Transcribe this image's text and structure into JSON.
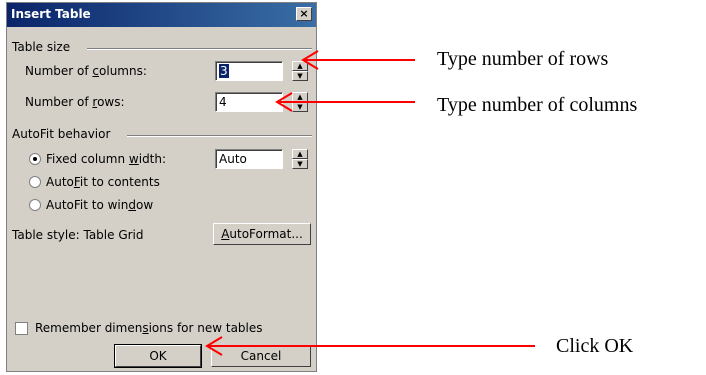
{
  "dialog": {
    "title": "Insert Table",
    "close_label": "×",
    "table_size": {
      "heading": "Table size",
      "columns_label_pre": "Number of ",
      "columns_label_u": "c",
      "columns_label_post": "olumns:",
      "columns_value": "3",
      "rows_label_pre": "Number of ",
      "rows_label_u": "r",
      "rows_label_post": "ows:",
      "rows_value": "4"
    },
    "autofit": {
      "heading": "AutoFit behavior",
      "fixed_pre": "Fixed column ",
      "fixed_u": "w",
      "fixed_post": "idth:",
      "fixed_value": "Auto",
      "contents_pre": "Auto",
      "contents_u": "F",
      "contents_post": "it to contents",
      "window_pre": "AutoFit to win",
      "window_u": "d",
      "window_post": "ow"
    },
    "table_style_label": "Table style: Table Grid",
    "autoformat_pre": "",
    "autoformat_u": "A",
    "autoformat_post": "utoFormat...",
    "remember_pre": "Remember dimen",
    "remember_u": "s",
    "remember_post": "ions for new tables",
    "ok_label": "OK",
    "cancel_label": "Cancel"
  },
  "annotations": {
    "rows_note": "Type number of rows",
    "columns_note": "Type number of columns",
    "ok_note": "Click OK"
  },
  "colors": {
    "arrow": "#ff0000",
    "titlebar": "#0a246a",
    "dialog_bg": "#d4d0c8"
  }
}
